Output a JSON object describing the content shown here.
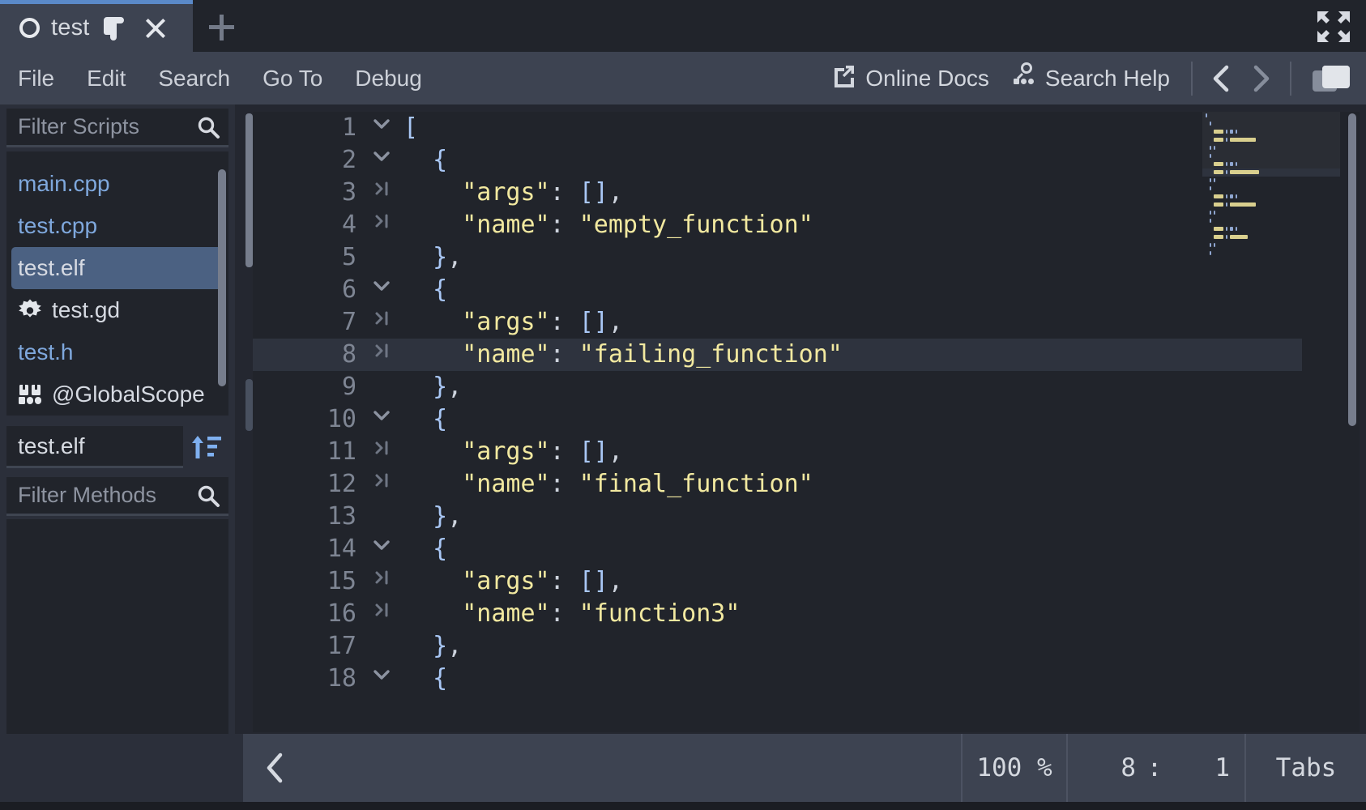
{
  "window": {
    "tab": {
      "icon": "circle-icon",
      "label": "test",
      "script_icon": "script-icon",
      "close_icon": "close-icon"
    },
    "add_tab_icon": "plus-icon",
    "fullscreen_icon": "fullscreen-icon"
  },
  "menubar": {
    "items": [
      {
        "label": "File"
      },
      {
        "label": "Edit"
      },
      {
        "label": "Search"
      },
      {
        "label": "Go To"
      },
      {
        "label": "Debug"
      }
    ],
    "actions": [
      {
        "label": "Online Docs",
        "icon": "external-link-icon"
      },
      {
        "label": "Search Help",
        "icon": "doc-search-icon"
      }
    ],
    "nav_prev_icon": "chevron-left-icon",
    "nav_next_icon": "chevron-right-icon",
    "panel_toggle_icon": "panel-icon"
  },
  "sidebar": {
    "filter_scripts": {
      "placeholder": "Filter Scripts",
      "value": "",
      "icon": "search-icon"
    },
    "scripts": [
      {
        "label": "main.cpp",
        "style": "cpp",
        "icon": null,
        "selected": false
      },
      {
        "label": "test.cpp",
        "style": "cpp",
        "icon": null,
        "selected": false
      },
      {
        "label": "test.elf",
        "style": "plain",
        "icon": null,
        "selected": true
      },
      {
        "label": "test.gd",
        "style": "plain",
        "icon": "gear-icon",
        "selected": false
      },
      {
        "label": "test.h",
        "style": "cpp",
        "icon": null,
        "selected": false
      },
      {
        "label": "@GlobalScope",
        "style": "plain",
        "icon": "doc-book-icon",
        "selected": false
      }
    ],
    "member_field": {
      "value": "test.elf"
    },
    "sort_icon": "sort-icon",
    "filter_methods": {
      "placeholder": "Filter Methods",
      "value": "",
      "icon": "search-icon"
    },
    "methods": []
  },
  "editor": {
    "lines": [
      {
        "num": "1",
        "fold": "chevron-down",
        "indent": 0,
        "tokens": [
          {
            "t": "[",
            "c": "p"
          }
        ]
      },
      {
        "num": "2",
        "fold": "chevron-down",
        "indent": 1,
        "tokens": [
          {
            "t": "{",
            "c": "p"
          }
        ]
      },
      {
        "num": "3",
        "fold": "arrow-right",
        "indent": 2,
        "tokens": [
          {
            "t": "\"args\"",
            "c": "k"
          },
          {
            "t": ": ",
            "c": "c"
          },
          {
            "t": "[]",
            "c": "p"
          },
          {
            "t": ",",
            "c": "c"
          }
        ]
      },
      {
        "num": "4",
        "fold": "arrow-right",
        "indent": 2,
        "tokens": [
          {
            "t": "\"name\"",
            "c": "k"
          },
          {
            "t": ": ",
            "c": "c"
          },
          {
            "t": "\"empty_function\"",
            "c": "k"
          }
        ]
      },
      {
        "num": "5",
        "fold": "",
        "indent": 1,
        "tokens": [
          {
            "t": "}",
            "c": "p"
          },
          {
            "t": ",",
            "c": "c"
          }
        ]
      },
      {
        "num": "6",
        "fold": "chevron-down",
        "indent": 1,
        "tokens": [
          {
            "t": "{",
            "c": "p"
          }
        ]
      },
      {
        "num": "7",
        "fold": "arrow-right",
        "indent": 2,
        "tokens": [
          {
            "t": "\"args\"",
            "c": "k"
          },
          {
            "t": ": ",
            "c": "c"
          },
          {
            "t": "[]",
            "c": "p"
          },
          {
            "t": ",",
            "c": "c"
          }
        ]
      },
      {
        "num": "8",
        "fold": "arrow-right",
        "indent": 2,
        "active": true,
        "tokens": [
          {
            "t": "\"name\"",
            "c": "k"
          },
          {
            "t": ": ",
            "c": "c"
          },
          {
            "t": "\"failing_function\"",
            "c": "k"
          }
        ]
      },
      {
        "num": "9",
        "fold": "",
        "indent": 1,
        "tokens": [
          {
            "t": "}",
            "c": "p"
          },
          {
            "t": ",",
            "c": "c"
          }
        ]
      },
      {
        "num": "10",
        "fold": "chevron-down",
        "indent": 1,
        "tokens": [
          {
            "t": "{",
            "c": "p"
          }
        ]
      },
      {
        "num": "11",
        "fold": "arrow-right",
        "indent": 2,
        "tokens": [
          {
            "t": "\"args\"",
            "c": "k"
          },
          {
            "t": ": ",
            "c": "c"
          },
          {
            "t": "[]",
            "c": "p"
          },
          {
            "t": ",",
            "c": "c"
          }
        ]
      },
      {
        "num": "12",
        "fold": "arrow-right",
        "indent": 2,
        "tokens": [
          {
            "t": "\"name\"",
            "c": "k"
          },
          {
            "t": ": ",
            "c": "c"
          },
          {
            "t": "\"final_function\"",
            "c": "k"
          }
        ]
      },
      {
        "num": "13",
        "fold": "",
        "indent": 1,
        "tokens": [
          {
            "t": "}",
            "c": "p"
          },
          {
            "t": ",",
            "c": "c"
          }
        ]
      },
      {
        "num": "14",
        "fold": "chevron-down",
        "indent": 1,
        "tokens": [
          {
            "t": "{",
            "c": "p"
          }
        ]
      },
      {
        "num": "15",
        "fold": "arrow-right",
        "indent": 2,
        "tokens": [
          {
            "t": "\"args\"",
            "c": "k"
          },
          {
            "t": ": ",
            "c": "c"
          },
          {
            "t": "[]",
            "c": "p"
          },
          {
            "t": ",",
            "c": "c"
          }
        ]
      },
      {
        "num": "16",
        "fold": "arrow-right",
        "indent": 2,
        "tokens": [
          {
            "t": "\"name\"",
            "c": "k"
          },
          {
            "t": ": ",
            "c": "c"
          },
          {
            "t": "\"function3\"",
            "c": "k"
          }
        ]
      },
      {
        "num": "17",
        "fold": "",
        "indent": 1,
        "tokens": [
          {
            "t": "}",
            "c": "p"
          },
          {
            "t": ",",
            "c": "c"
          }
        ]
      },
      {
        "num": "18",
        "fold": "chevron-down",
        "indent": 1,
        "tokens": [
          {
            "t": "{",
            "c": "p"
          }
        ]
      }
    ]
  },
  "statusbar": {
    "back_icon": "chevron-left-icon",
    "zoom": "100 %",
    "cursor_line": "8",
    "cursor_sep": ":",
    "cursor_col": "1",
    "indent_mode": "Tabs"
  },
  "colors": {
    "accent": "#5a89c8",
    "selection": "#4b6182",
    "string": "#f2e9a0",
    "punct": "#a9c7f5",
    "bg_panel": "#2b2f3a",
    "bg_editor": "#21242b",
    "bg_bar": "#3d4351"
  }
}
